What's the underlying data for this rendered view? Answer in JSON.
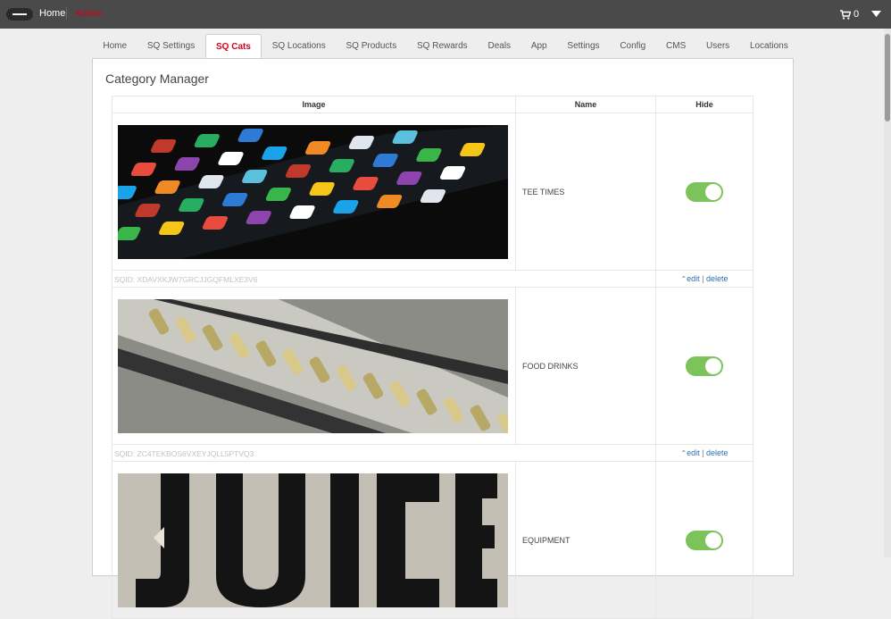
{
  "topbar": {
    "home_label": "Home",
    "admin_label": "Admin",
    "cart_count": "0",
    "icons": {
      "menu": "hamburger-menu-icon",
      "cart": "cart-icon",
      "caret": "caret-down-icon"
    }
  },
  "tabs": [
    {
      "label": "Home",
      "active": false
    },
    {
      "label": "SQ Settings",
      "active": false
    },
    {
      "label": "SQ Cats",
      "active": true
    },
    {
      "label": "SQ Locations",
      "active": false
    },
    {
      "label": "SQ Products",
      "active": false
    },
    {
      "label": "SQ Rewards",
      "active": false
    },
    {
      "label": "Deals",
      "active": false
    },
    {
      "label": "App",
      "active": false
    },
    {
      "label": "Settings",
      "active": false
    },
    {
      "label": "Config",
      "active": false
    },
    {
      "label": "CMS",
      "active": false
    },
    {
      "label": "Users",
      "active": false
    },
    {
      "label": "Locations",
      "active": false
    }
  ],
  "panel": {
    "title": "Category Manager",
    "columns": {
      "image": "Image",
      "name": "Name",
      "hide": "Hide"
    }
  },
  "categories": [
    {
      "name": "TEE TIMES",
      "sqid": "SQID: XDAVXKJW7GRCJJGQFMLXE3V6",
      "hidden": true,
      "edit_label": "edit",
      "delete_label": "delete"
    },
    {
      "name": "FOOD DRINKS",
      "sqid": "SQID: ZC4TEKBOS6VXEYJQLL5PTVQ3",
      "hidden": true,
      "edit_label": "edit",
      "delete_label": "delete"
    },
    {
      "name": "EQUIPMENT",
      "hidden": true
    }
  ],
  "colors": {
    "topbar": "#4a4a4a",
    "accent_red": "#d0021b",
    "toggle_on": "#7dc35b",
    "link_blue": "#2a6fb0"
  }
}
